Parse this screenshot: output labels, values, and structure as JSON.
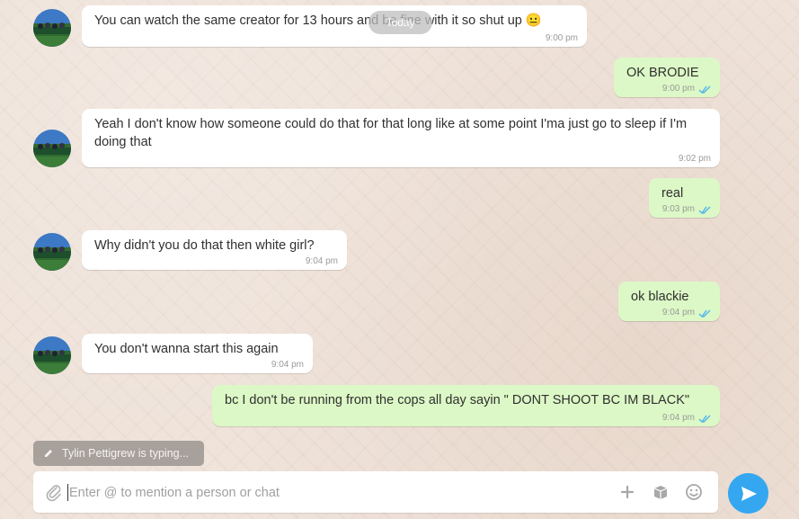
{
  "date_pill": "Today",
  "messages": [
    {
      "text": "You can watch the same creator for 13 hours and be fine with it so shut up 😐",
      "time": "9:00 pm"
    },
    {
      "text": "OK BRODIE",
      "time": "9:00 pm"
    },
    {
      "text": "Yeah I don't know how someone could do that for that long like at some point I'ma just go to sleep if I'm doing that",
      "time": "9:02 pm"
    },
    {
      "text": "real",
      "time": "9:03 pm"
    },
    {
      "text": "Why didn't you do that then white girl?",
      "time": "9:04 pm"
    },
    {
      "text": "ok blackie",
      "time": "9:04 pm"
    },
    {
      "text": "You don't wanna start this again",
      "time": "9:04 pm"
    },
    {
      "text": "bc I don't be running from the cops all day sayin \" DONT SHOOT BC IM BLACK\"",
      "time": "9:04 pm"
    }
  ],
  "typing_indicator": "Tylin Pettigrew is typing...",
  "composer": {
    "placeholder": "Enter @ to mention a person or chat"
  },
  "colors": {
    "outgoing_bubble": "#dcf8c6",
    "incoming_bubble": "#ffffff",
    "read_ticks": "#4fb6ec",
    "send_button": "#34a7f0"
  },
  "icons": {
    "attach": "paperclip-icon",
    "add": "plus-icon",
    "box": "package-icon",
    "emoji": "emoji-icon",
    "send": "send-icon",
    "typing": "pencil-icon",
    "read": "double-check-icon"
  }
}
